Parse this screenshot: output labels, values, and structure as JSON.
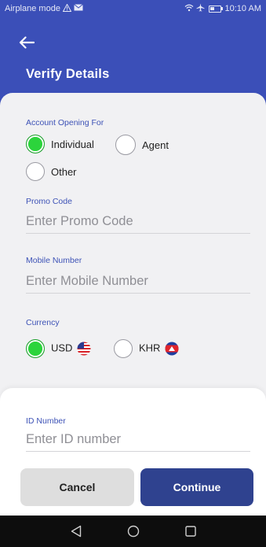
{
  "status_bar": {
    "left_text": "Airplane mode",
    "time": "10:10 AM",
    "icons": [
      "warning-icon",
      "mail-icon",
      "wifi-icon",
      "airplane-icon",
      "battery-icon"
    ]
  },
  "header": {
    "title": "Verify Details",
    "back_icon": "arrow-left-icon",
    "color": "#3b4fb8"
  },
  "account_opening": {
    "label": "Account Opening For",
    "options": [
      {
        "label": "Individual",
        "selected": true
      },
      {
        "label": "Agent",
        "selected": false
      },
      {
        "label": "Other",
        "selected": false
      }
    ]
  },
  "promo_code": {
    "label": "Promo Code",
    "placeholder": "Enter Promo Code",
    "value": ""
  },
  "mobile_number": {
    "label": "Mobile Number",
    "placeholder": "Enter Mobile Number",
    "value": ""
  },
  "currency": {
    "label": "Currency",
    "options": [
      {
        "label": "USD",
        "selected": true,
        "flag": "us-flag-icon"
      },
      {
        "label": "KHR",
        "selected": false,
        "flag": "cambodia-flag-icon"
      }
    ]
  },
  "id_number": {
    "label": "ID Number",
    "placeholder": "Enter ID number",
    "value": ""
  },
  "actions": {
    "cancel_label": "Cancel",
    "continue_label": "Continue",
    "continue_color": "#2f428f"
  },
  "nav_bar": {
    "icons": [
      "back-triangle-icon",
      "home-circle-icon",
      "recents-square-icon"
    ]
  }
}
